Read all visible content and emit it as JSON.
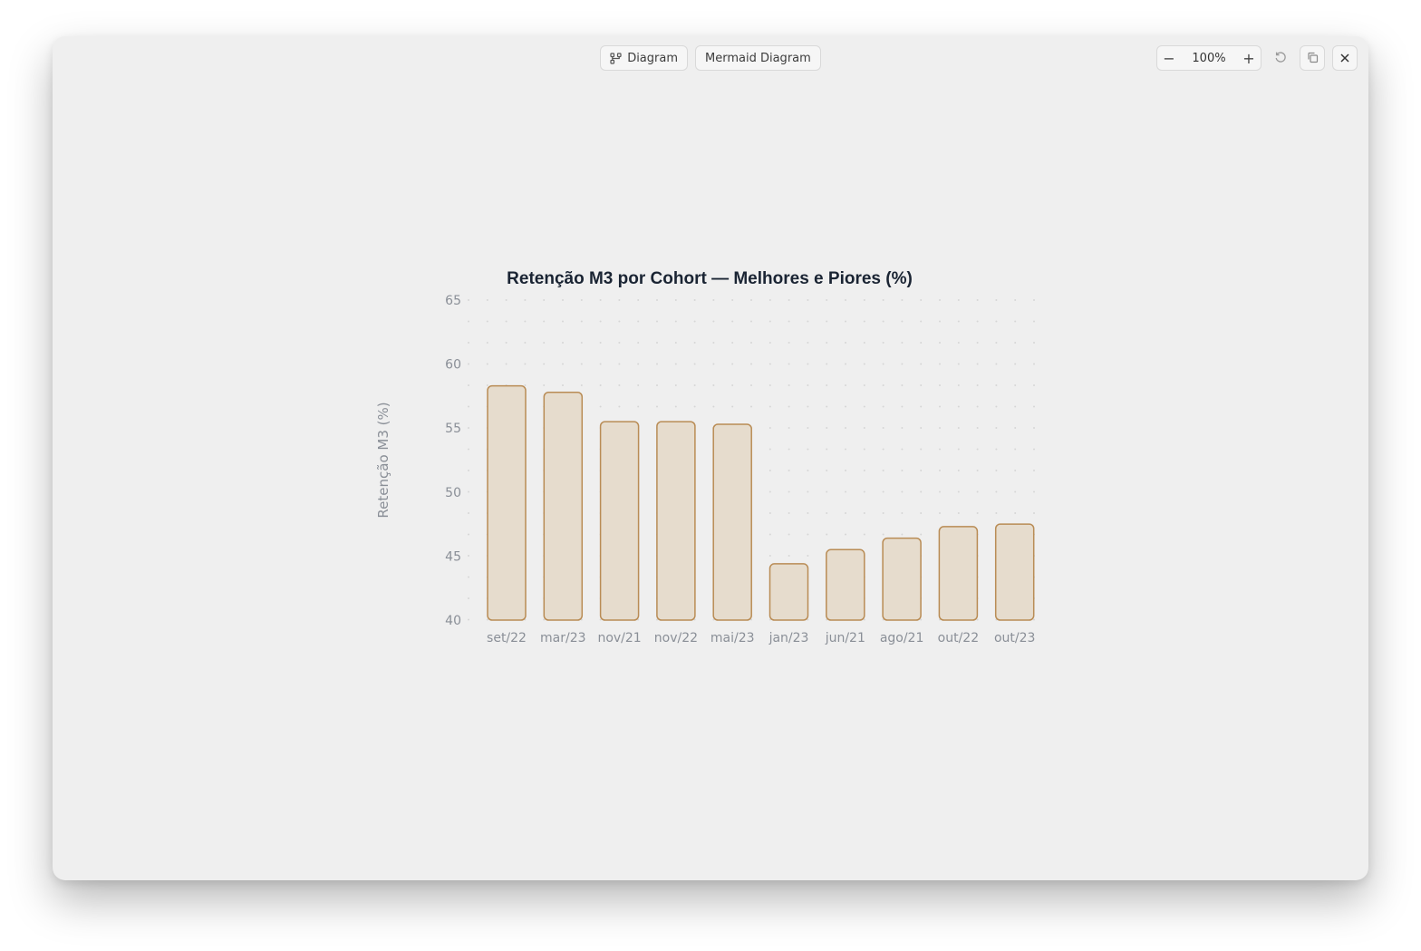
{
  "toolbar": {
    "diagram_label": "Diagram",
    "mermaid_label": "Mermaid Diagram",
    "zoom_out": "−",
    "zoom_level": "100%",
    "zoom_in": "+"
  },
  "icons": {
    "diagram": "diagram-icon",
    "reset": "reset-icon",
    "copy": "copy-icon",
    "close": "close-icon"
  },
  "colors": {
    "bar_fill": "#e6dccd",
    "bar_stroke": "#b98c55",
    "grid_dot": "#d6d6d6"
  },
  "chart_data": {
    "type": "bar",
    "title": "Retenção M3 por Cohort — Melhores e Piores (%)",
    "xlabel": "",
    "ylabel": "Retenção M3 (%)",
    "categories": [
      "set/22",
      "mar/23",
      "nov/21",
      "nov/22",
      "mai/23",
      "jan/23",
      "jun/21",
      "ago/21",
      "out/22",
      "out/23"
    ],
    "values": [
      58.3,
      57.8,
      55.5,
      55.5,
      55.3,
      44.4,
      45.5,
      46.4,
      47.3,
      47.5
    ],
    "ylim": [
      40,
      65
    ],
    "yticks": [
      40,
      45,
      50,
      55,
      60,
      65
    ],
    "grid": true,
    "legend": "none"
  }
}
